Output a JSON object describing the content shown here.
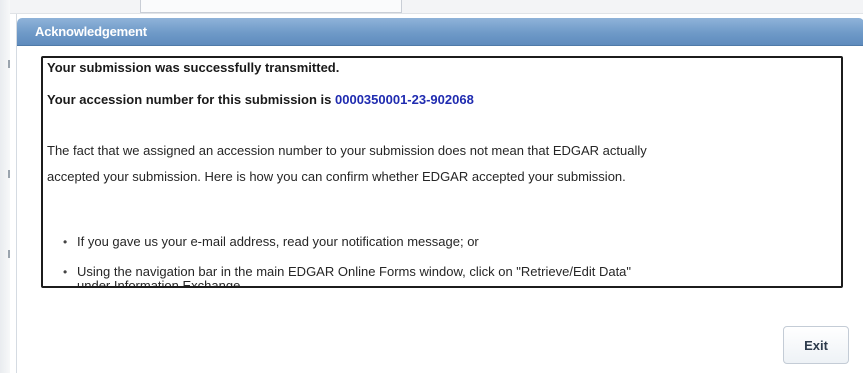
{
  "dialog": {
    "title": "Acknowledgement",
    "line1": "Your submission was successfully transmitted.",
    "line2_prefix": "Your accession number for this submission is ",
    "accession_number": "0000350001-23-902068",
    "para_line1": "The fact that we assigned an accession number to your submission does not mean that EDGAR actually",
    "para_line2": "accepted your submission. Here is how you can confirm whether EDGAR accepted your submission.",
    "bullets": [
      {
        "text": "If you gave us your e-mail address, read your notification message; or"
      },
      {
        "line1": "Using the navigation bar in the main EDGAR Online Forms window, click on \"Retrieve/Edit Data\"",
        "line2": "under Information Exchange."
      }
    ],
    "bullet_glyph": "•",
    "exit_label": "Exit"
  },
  "colors": {
    "titlebar": "#6f9ac8",
    "accession_link": "#1f2bb0",
    "box_border": "#1c1c1c"
  }
}
